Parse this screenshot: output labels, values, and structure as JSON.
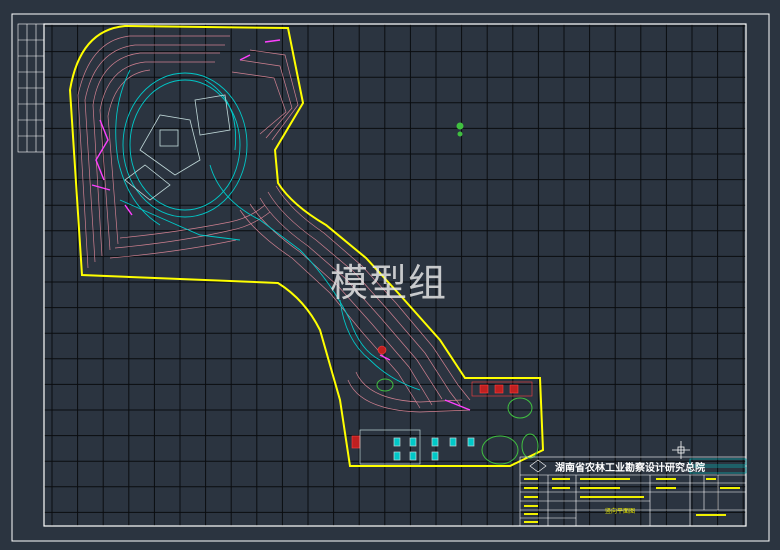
{
  "watermark": "模型组",
  "title_block": {
    "org_name": "湖南省农林工业勘察设计研究总院",
    "drawing_name": "竖向平面图"
  },
  "colors": {
    "background": "#2b3440",
    "grid": "#0a0c0f",
    "frame": "#ffffff",
    "boundary": "#ffff00",
    "contours": "#d08090",
    "paths": "#00c8c8",
    "accents": "#ff40ff",
    "vegetation": "#40c040"
  }
}
